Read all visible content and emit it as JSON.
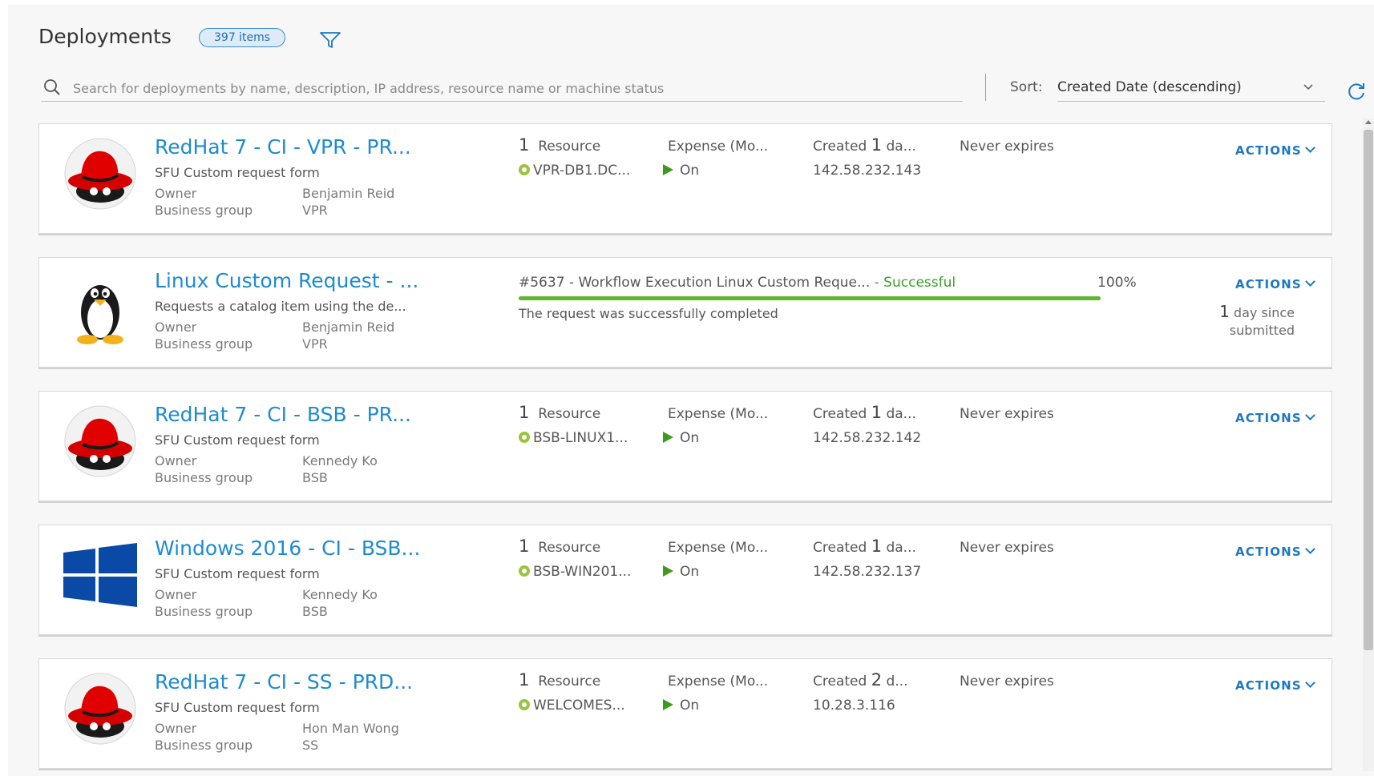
{
  "header": {
    "title": "Deployments",
    "count_badge": "397 items"
  },
  "search": {
    "placeholder": "Search for deployments by name, description, IP address, resource name or machine status"
  },
  "sort": {
    "label": "Sort:",
    "value": "Created Date (descending)"
  },
  "common": {
    "owner_label": "Owner",
    "group_label": "Business group",
    "actions_label": "ACTIONS"
  },
  "deployments": [
    {
      "icon": "redhat-logo",
      "title": "RedHat 7 - CI - VPR - PR...",
      "subtitle": "SFU Custom request form",
      "owner": "Benjamin Reid",
      "group": "VPR",
      "resource_count": "1",
      "resource_label": "Resource",
      "resource_name": "VPR-DB1.DC...",
      "expense": "Expense (Mo...",
      "power": "On",
      "created_prefix": "Created",
      "created_num": "1",
      "created_suffix": "da...",
      "ip": "142.58.232.143",
      "expires": "Never expires"
    },
    {
      "icon": "linux-tux-logo",
      "title": "Linux Custom Request - ...",
      "subtitle": "Requests a catalog item using the de...",
      "owner": "Benjamin Reid",
      "group": "VPR",
      "request": "#5637 - Workflow Execution Linux Custom Reque...",
      "status": "- Successful",
      "progress_pct": 100,
      "progress_text": "100%",
      "message": "The request was successfully completed",
      "since_num": "1",
      "since_line1": "day since",
      "since_line2": "submitted"
    },
    {
      "icon": "redhat-logo",
      "title": "RedHat 7 - CI - BSB - PR...",
      "subtitle": "SFU Custom request form",
      "owner": "Kennedy Ko",
      "group": "BSB",
      "resource_count": "1",
      "resource_label": "Resource",
      "resource_name": "BSB-LINUX1...",
      "expense": "Expense (Mo...",
      "power": "On",
      "created_prefix": "Created",
      "created_num": "1",
      "created_suffix": "da...",
      "ip": "142.58.232.142",
      "expires": "Never expires"
    },
    {
      "icon": "windows-logo",
      "title": "Windows 2016 - CI - BSB...",
      "subtitle": "SFU Custom request form",
      "owner": "Kennedy Ko",
      "group": "BSB",
      "resource_count": "1",
      "resource_label": "Resource",
      "resource_name": "BSB-WIN201...",
      "expense": "Expense (Mo...",
      "power": "On",
      "created_prefix": "Created",
      "created_num": "1",
      "created_suffix": "da...",
      "ip": "142.58.232.137",
      "expires": "Never expires"
    },
    {
      "icon": "redhat-logo",
      "title": "RedHat 7 - CI - SS - PRD...",
      "subtitle": "SFU Custom request form",
      "owner": "Hon Man Wong",
      "group": "SS",
      "resource_count": "1",
      "resource_label": "Resource",
      "resource_name": "WELCOMES...",
      "expense": "Expense (Mo...",
      "power": "On",
      "created_prefix": "Created",
      "created_num": "2",
      "created_suffix": "d...",
      "ip": "10.28.3.116",
      "expires": "Never expires"
    }
  ]
}
